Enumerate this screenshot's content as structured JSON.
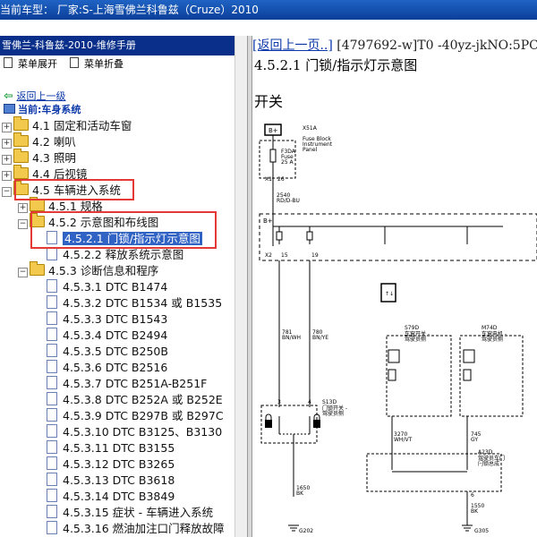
{
  "window": {
    "title": "当前车型：  厂家:S-上海雪佛兰科鲁兹（Cruze）2010"
  },
  "left_panel": {
    "title": "雪佛兰-科鲁兹-2010-维修手册",
    "expand_label": "菜单展开",
    "collapse_label": "菜单折叠",
    "back_link": "返回上一级",
    "current": "当前:车身系统",
    "tree": [
      {
        "label": "4.1 固定和活动车窗"
      },
      {
        "label": "4.2 喇叭"
      },
      {
        "label": "4.3 照明"
      },
      {
        "label": "4.4 后视镜"
      },
      {
        "label": "4.5 车辆进入系统"
      },
      {
        "label": "4.5.1 规格"
      },
      {
        "label": "4.5.2 示意图和布线图"
      },
      {
        "label": "4.5.2.1 门锁/指示灯示意图"
      },
      {
        "label": "4.5.2.2 释放系统示意图"
      },
      {
        "label": "4.5.3 诊断信息和程序"
      },
      {
        "label": "4.5.3.1 DTC B1474"
      },
      {
        "label": "4.5.3.2 DTC B1534 或 B1535"
      },
      {
        "label": "4.5.3.3 DTC B1543"
      },
      {
        "label": "4.5.3.4 DTC B2494"
      },
      {
        "label": "4.5.3.5 DTC B250B"
      },
      {
        "label": "4.5.3.6 DTC B2516"
      },
      {
        "label": "4.5.3.7 DTC B251A-B251F"
      },
      {
        "label": "4.5.3.8 DTC B252A 或 B252E"
      },
      {
        "label": "4.5.3.9 DTC B297B 或 B297C"
      },
      {
        "label": "4.5.3.10 DTC B3125、B3130"
      },
      {
        "label": "4.5.3.11 DTC B3155"
      },
      {
        "label": "4.5.3.12 DTC B3265"
      },
      {
        "label": "4.5.3.13 DTC B3618"
      },
      {
        "label": "4.5.3.14 DTC B3849"
      },
      {
        "label": "4.5.3.15 症状 - 车辆进入系统"
      },
      {
        "label": "4.5.3.16 燃油加注口门释放故障"
      }
    ]
  },
  "right_panel": {
    "back_link": "[返回上一页..]",
    "doc_code": "[4797692-w]T0 -40yz-jkNO:5PC",
    "heading": "4.5.2.1 门锁/指示灯示意图",
    "section": "开关",
    "diagram": {
      "bplus": "B+",
      "x51a": "X51A",
      "fuse_block": "Fuse Block",
      "instrument": "Instrument",
      "panel": "Panel",
      "f3da": "F3DA",
      "fuse": "Fuse",
      "amp": "25 A",
      "x1": "X1",
      "pin26": "26",
      "w2540": "2540",
      "c2540": "RD/D-BU",
      "bplus2": "B+",
      "x2": "X2",
      "pin15": "15",
      "pin19": "19",
      "w781": "781",
      "c781": "BN/WH",
      "w780": "780",
      "c780": "BN/YE",
      "s79d": "S79D",
      "s79d_desc1": "车窗开关 -",
      "s79d_desc2": "驾驶员侧",
      "m74d": "M74D",
      "m74d_desc1": "车窗电机 -",
      "m74d_desc2": "驾驶员侧",
      "s13d": "S13D",
      "s13d_desc1": "门锁开关 -",
      "s13d_desc2": "驾驶员侧",
      "pin3": "3",
      "pin4": "4",
      "w3270": "3270",
      "c3270": "WH/VT",
      "w745": "745",
      "c745": "GY",
      "a23d": "A23D",
      "a23d_desc1": "驾驶员车门",
      "a23d_desc2": "闩锁总成",
      "pin6": "6",
      "w1550": "1550",
      "c1550": "BK",
      "w1650": "1650",
      "c1650": "BK",
      "g202": "G202",
      "g305": "G305"
    }
  }
}
